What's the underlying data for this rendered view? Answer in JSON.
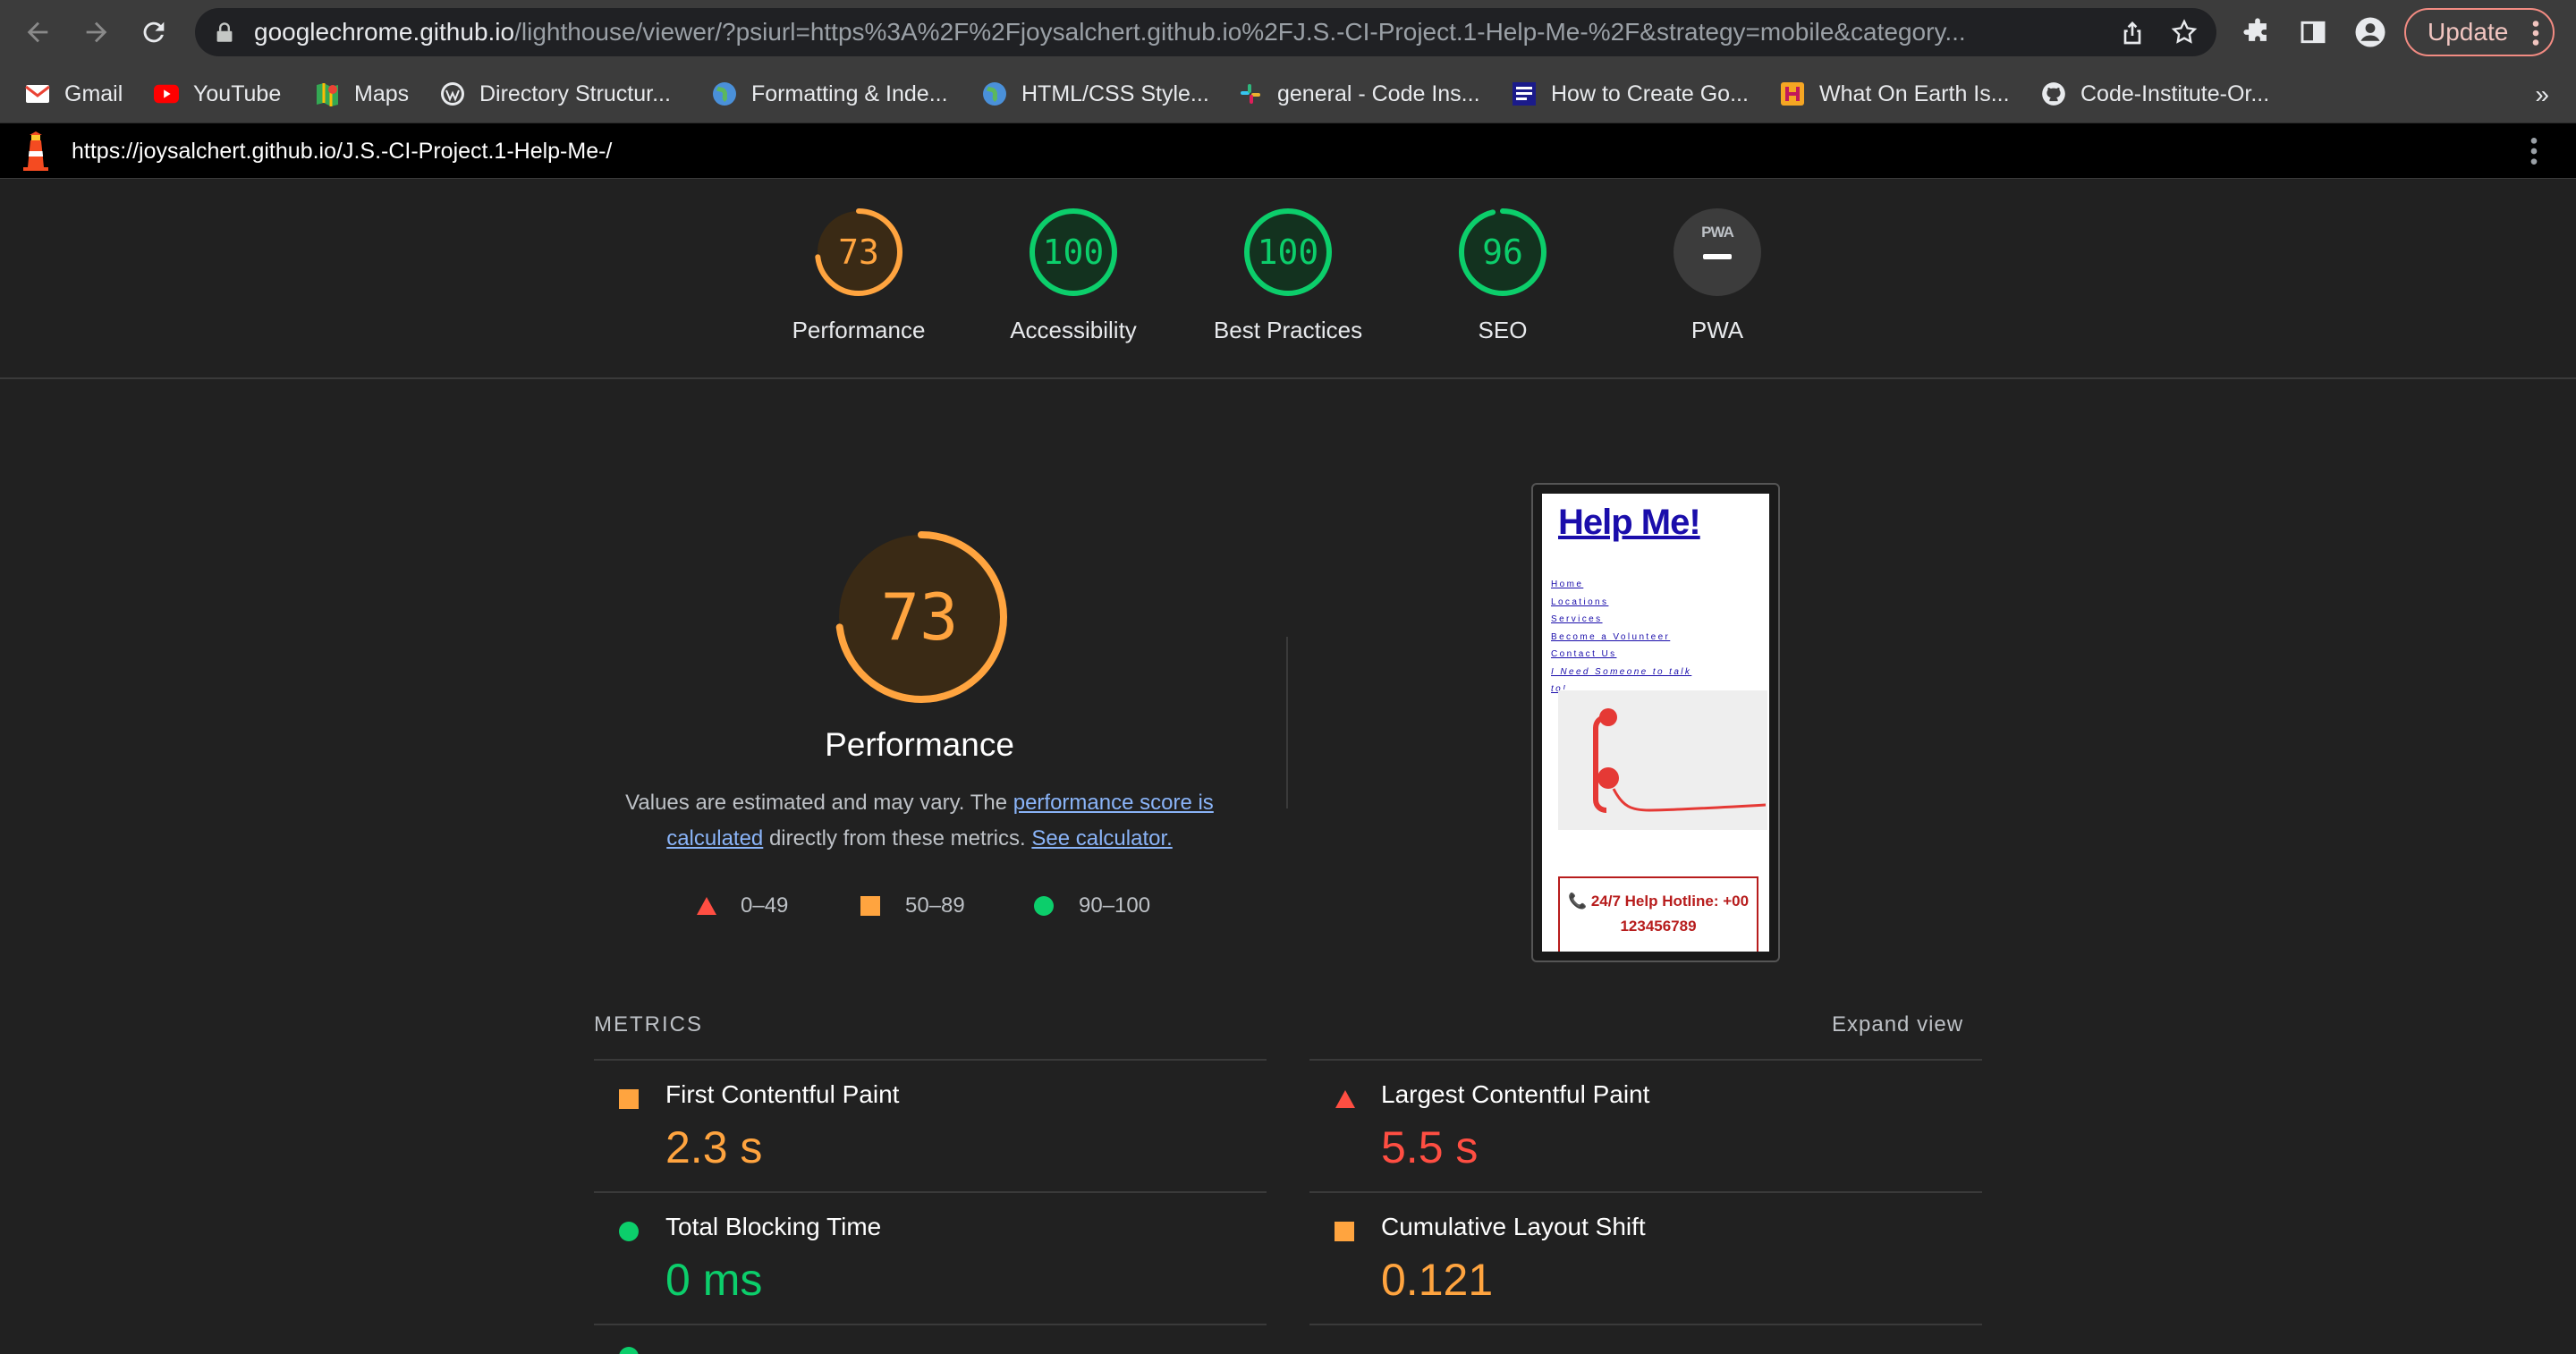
{
  "browser": {
    "url_host": "googlechrome.github.io",
    "url_rest": "/lighthouse/viewer/?psiurl=https%3A%2F%2Fjoysalchert.github.io%2FJ.S.-CI-Project.1-Help-Me-%2F&strategy=mobile&category...",
    "update_label": "Update"
  },
  "bookmarks": [
    {
      "label": "Gmail",
      "icon": "gmail-icon"
    },
    {
      "label": "YouTube",
      "icon": "youtube-icon"
    },
    {
      "label": "Maps",
      "icon": "maps-icon"
    },
    {
      "label": "Directory Structur...",
      "icon": "wordpress-icon"
    },
    {
      "label": "Formatting & Inde...",
      "icon": "globe-icon"
    },
    {
      "label": "HTML/CSS Style...",
      "icon": "globe-icon"
    },
    {
      "label": "general - Code Ins...",
      "icon": "slack-icon"
    },
    {
      "label": "How to Create Go...",
      "icon": "site-icon"
    },
    {
      "label": "What On Earth Is...",
      "icon": "h-icon"
    },
    {
      "label": "Code-Institute-Or...",
      "icon": "github-icon"
    }
  ],
  "bookmarks_more": "»",
  "lighthouse": {
    "tested_url": "https://joysalchert.github.io/J.S.-CI-Project.1-Help-Me-/",
    "gauges": [
      {
        "label": "Performance",
        "value": "73",
        "score": 0.73,
        "color": "#ffa43f"
      },
      {
        "label": "Accessibility",
        "value": "100",
        "score": 1.0,
        "color": "#0cce6b"
      },
      {
        "label": "Best Practices",
        "value": "100",
        "score": 1.0,
        "color": "#0cce6b"
      },
      {
        "label": "SEO",
        "value": "96",
        "score": 0.96,
        "color": "#0cce6b"
      },
      {
        "label": "PWA",
        "value": "",
        "score": 0,
        "color": "#9aa0a6"
      }
    ],
    "pwa_badge": "PWA",
    "summary": {
      "score": "73",
      "score_fraction": 0.73,
      "title": "Performance",
      "desc_1": "Values are estimated and may vary. The ",
      "desc_link_1": "performance score is calculated",
      "desc_2": " directly from these metrics. ",
      "desc_link_2": "See calculator."
    },
    "legend": [
      {
        "shape": "triangle",
        "label": "0–49",
        "color": "#ff4e42"
      },
      {
        "shape": "square",
        "label": "50–89",
        "color": "#ffa43f"
      },
      {
        "shape": "circle",
        "label": "90–100",
        "color": "#0cce6b"
      }
    ],
    "screenshot": {
      "title": "Help Me!",
      "nav": [
        "Home",
        "Locations",
        "Services",
        "Become a Volunteer",
        "Contact Us",
        "I Need Someone to talk",
        "to!"
      ],
      "hotline_1": "📞 24/7 Help Hotline: +00",
      "hotline_2": "123456789"
    },
    "metrics_heading": "METRICS",
    "expand_label": "Expand view",
    "metrics": [
      {
        "name": "First Contentful Paint",
        "value": "2.3 s",
        "rating": "average",
        "color": "#ffa43f"
      },
      {
        "name": "Largest Contentful Paint",
        "value": "5.5 s",
        "rating": "fail",
        "color": "#ff4e42"
      },
      {
        "name": "Total Blocking Time",
        "value": "0 ms",
        "rating": "pass",
        "color": "#0cce6b"
      },
      {
        "name": "Cumulative Layout Shift",
        "value": "0.121",
        "rating": "average",
        "color": "#ffa43f"
      }
    ]
  }
}
